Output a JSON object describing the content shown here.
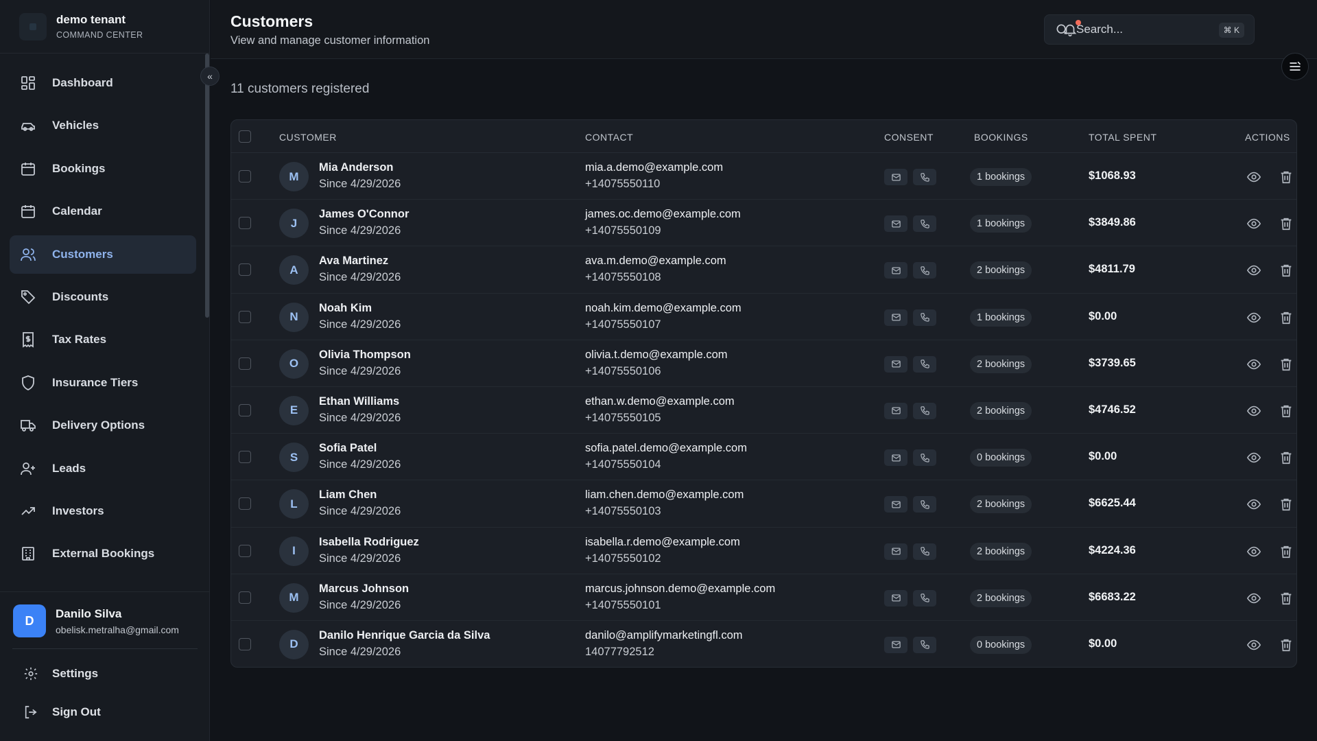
{
  "brand": {
    "name": "demo tenant",
    "subtitle": "COMMAND CENTER"
  },
  "sidebar": {
    "items": [
      {
        "label": "Dashboard",
        "icon": "dashboard-icon"
      },
      {
        "label": "Vehicles",
        "icon": "car-icon"
      },
      {
        "label": "Bookings",
        "icon": "calendar-icon"
      },
      {
        "label": "Calendar",
        "icon": "calendar-grid-icon"
      },
      {
        "label": "Customers",
        "icon": "users-icon",
        "active": true
      },
      {
        "label": "Discounts",
        "icon": "tag-icon"
      },
      {
        "label": "Tax Rates",
        "icon": "receipt-icon"
      },
      {
        "label": "Insurance Tiers",
        "icon": "shield-icon"
      },
      {
        "label": "Delivery Options",
        "icon": "truck-icon"
      },
      {
        "label": "Leads",
        "icon": "user-plus-icon"
      },
      {
        "label": "Investors",
        "icon": "trending-up-icon"
      },
      {
        "label": "External Bookings",
        "icon": "building-icon"
      }
    ],
    "collapse_glyph": "«"
  },
  "user": {
    "initial": "D",
    "name": "Danilo Silva",
    "email": "obelisk.metralha@gmail.com"
  },
  "bottom_nav": {
    "settings": "Settings",
    "sign_out": "Sign Out"
  },
  "header": {
    "title": "Customers",
    "subtitle": "View and manage customer information",
    "search_placeholder": "Search...",
    "shortcut": "⌘ K"
  },
  "main": {
    "count_text": "11 customers registered"
  },
  "table": {
    "columns": [
      "CUSTOMER",
      "CONTACT",
      "CONSENT",
      "BOOKINGS",
      "TOTAL SPENT",
      "ACTIONS"
    ],
    "rows": [
      {
        "initial": "M",
        "name": "Mia Anderson",
        "since": "Since 4/29/2026",
        "email": "mia.a.demo@example.com",
        "phone": "+14075550110",
        "bookings": "1 bookings",
        "spent": "$1068.93"
      },
      {
        "initial": "J",
        "name": "James O'Connor",
        "since": "Since 4/29/2026",
        "email": "james.oc.demo@example.com",
        "phone": "+14075550109",
        "bookings": "1 bookings",
        "spent": "$3849.86"
      },
      {
        "initial": "A",
        "name": "Ava Martinez",
        "since": "Since 4/29/2026",
        "email": "ava.m.demo@example.com",
        "phone": "+14075550108",
        "bookings": "2 bookings",
        "spent": "$4811.79"
      },
      {
        "initial": "N",
        "name": "Noah Kim",
        "since": "Since 4/29/2026",
        "email": "noah.kim.demo@example.com",
        "phone": "+14075550107",
        "bookings": "1 bookings",
        "spent": "$0.00"
      },
      {
        "initial": "O",
        "name": "Olivia Thompson",
        "since": "Since 4/29/2026",
        "email": "olivia.t.demo@example.com",
        "phone": "+14075550106",
        "bookings": "2 bookings",
        "spent": "$3739.65"
      },
      {
        "initial": "E",
        "name": "Ethan Williams",
        "since": "Since 4/29/2026",
        "email": "ethan.w.demo@example.com",
        "phone": "+14075550105",
        "bookings": "2 bookings",
        "spent": "$4746.52"
      },
      {
        "initial": "S",
        "name": "Sofia Patel",
        "since": "Since 4/29/2026",
        "email": "sofia.patel.demo@example.com",
        "phone": "+14075550104",
        "bookings": "0 bookings",
        "spent": "$0.00"
      },
      {
        "initial": "L",
        "name": "Liam Chen",
        "since": "Since 4/29/2026",
        "email": "liam.chen.demo@example.com",
        "phone": "+14075550103",
        "bookings": "2 bookings",
        "spent": "$6625.44"
      },
      {
        "initial": "I",
        "name": "Isabella Rodriguez",
        "since": "Since 4/29/2026",
        "email": "isabella.r.demo@example.com",
        "phone": "+14075550102",
        "bookings": "2 bookings",
        "spent": "$4224.36"
      },
      {
        "initial": "M",
        "name": "Marcus Johnson",
        "since": "Since 4/29/2026",
        "email": "marcus.johnson.demo@example.com",
        "phone": "+14075550101",
        "bookings": "2 bookings",
        "spent": "$6683.22"
      },
      {
        "initial": "D",
        "name": "Danilo Henrique Garcia da Silva",
        "since": "Since 4/29/2026",
        "email": "danilo@amplifymarketingfl.com",
        "phone": "14077792512",
        "bookings": "0 bookings",
        "spent": "$0.00"
      }
    ]
  },
  "colors": {
    "accent": "#8fb3ec",
    "avatar_bg": "#3b82f6",
    "notification_dot": "#f26c5a",
    "background": "#111419",
    "panel": "#1b1f26"
  }
}
